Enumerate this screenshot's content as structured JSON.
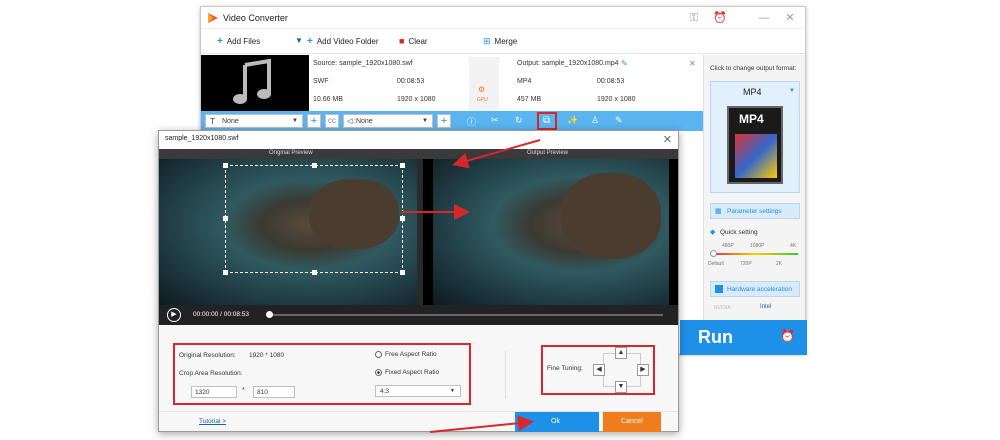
{
  "app": {
    "title": "Video Converter"
  },
  "toolbar": {
    "add_files": "Add Files",
    "add_folder": "Add Video Folder",
    "clear": "Clear",
    "merge": "Merge"
  },
  "file": {
    "source_label": "Source: sample_1920x1080.swf",
    "src_format": "SWF",
    "src_duration": "00:08:53",
    "src_size": "10.66 MB",
    "src_res": "1920 x 1080",
    "gpu": "GPU",
    "output_label": "Output: sample_1920x1080.mp4",
    "out_format": "MP4",
    "out_duration": "00:08:53",
    "out_size": "457 MB",
    "out_res": "1920 x 1080"
  },
  "editbar": {
    "subtitle": "None",
    "audio": ":None"
  },
  "right": {
    "format_hint": "Click to change output format:",
    "format": "MP4",
    "format_badge": "MP4",
    "param_settings": "Parameter settings",
    "quick_setting": "Quick setting",
    "q_top": [
      "480P",
      "1080P",
      "4K"
    ],
    "q_bottom": [
      "Default",
      "720P",
      "2K"
    ],
    "hw_accel": "Hardware acceleration",
    "nvidia": "NVIDIA",
    "intel": "Intel",
    "run": "Run"
  },
  "dialog": {
    "title": "sample_1920x1080.swf",
    "original_preview": "Original Preview",
    "output_preview": "Output Preview",
    "time": "00:00:00 / 00:08:53",
    "orig_res_label": "Original Resolution:",
    "orig_res_value": "1920 * 1080",
    "crop_res_label": "Crop Area Resolution:",
    "crop_w": "1320",
    "crop_h": "810",
    "mult": "*",
    "free_ratio": "Free Aspect Ratio",
    "fixed_ratio": "Fixed Aspect Ratio",
    "ratio_value": "4:3",
    "fine_tuning": "Fine Tuning:",
    "tutorial": "Tutorial >",
    "ok": "Ok",
    "cancel": "Cancel"
  },
  "colors": {
    "accent": "#1e90e8",
    "highlight": "#d8272b",
    "cancel": "#f07c1e",
    "strip": "#5ab4ef"
  }
}
